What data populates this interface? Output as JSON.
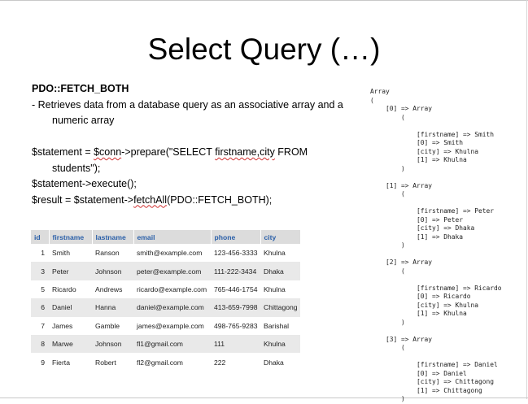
{
  "slide": {
    "title": "Select Query (…)",
    "heading": "PDO::FETCH_BOTH",
    "desc_line1": "- Retrieves data from a database query as an associative array and a",
    "desc_line2": "numeric array",
    "code1_a": "$statement = ",
    "code1_b": "$conn",
    "code1_c": "->prepare(\"SELECT ",
    "code1_d": "firstname,city",
    "code1_e": " FROM",
    "code1_f": "students\");",
    "code2": "$statement->execute();",
    "code3_a": "$result = $statement->",
    "code3_b": "fetchAll",
    "code3_c": "(PDO::FETCH_BOTH);"
  },
  "table": {
    "headers": [
      "id",
      "firstname",
      "lastname",
      "email",
      "phone",
      "city"
    ],
    "rows": [
      [
        "1",
        "Smith",
        "Ranson",
        "smith@example.com",
        "123-456-3333",
        "Khulna"
      ],
      [
        "3",
        "Peter",
        "Johnson",
        "peter@example.com",
        "111-222-3434",
        "Dhaka"
      ],
      [
        "5",
        "Ricardo",
        "Andrews",
        "ricardo@example.com",
        "765-446-1754",
        "Khulna"
      ],
      [
        "6",
        "Daniel",
        "Hanna",
        "daniel@example.com",
        "413-659-7998",
        "Chittagong"
      ],
      [
        "7",
        "James",
        "Gamble",
        "james@example.com",
        "498-765-9283",
        "Barishal"
      ],
      [
        "8",
        "Marwe",
        "Johnson",
        "fl1@gmail.com",
        "111",
        "Khulna"
      ],
      [
        "9",
        "Fierta",
        "Robert",
        "fl2@gmail.com",
        "222",
        "Dhaka"
      ]
    ]
  },
  "dump": {
    "header": [
      "Array",
      "("
    ],
    "entries": [
      {
        "index": "    [0] => Array",
        "firstname": "            [firstname] => Smith",
        "num0": "            [0] => Smith",
        "city": "            [city] => Khulna",
        "num1": "            [1] => Khulna"
      },
      {
        "index": "    [1] => Array",
        "firstname": "            [firstname] => Peter",
        "num0": "            [0] => Peter",
        "city": "            [city] => Dhaka",
        "num1": "            [1] => Dhaka"
      },
      {
        "index": "    [2] => Array",
        "firstname": "            [firstname] => Ricardo",
        "num0": "            [0] => Ricardo",
        "city": "            [city] => Khulna",
        "num1": "            [1] => Khulna"
      },
      {
        "index": "    [3] => Array",
        "firstname": "            [firstname] => Daniel",
        "num0": "            [0] => Daniel",
        "city": "            [city] => Chittagong",
        "num1": "            [1] => Chittagong"
      }
    ],
    "open": "        (",
    "close": "        )"
  }
}
